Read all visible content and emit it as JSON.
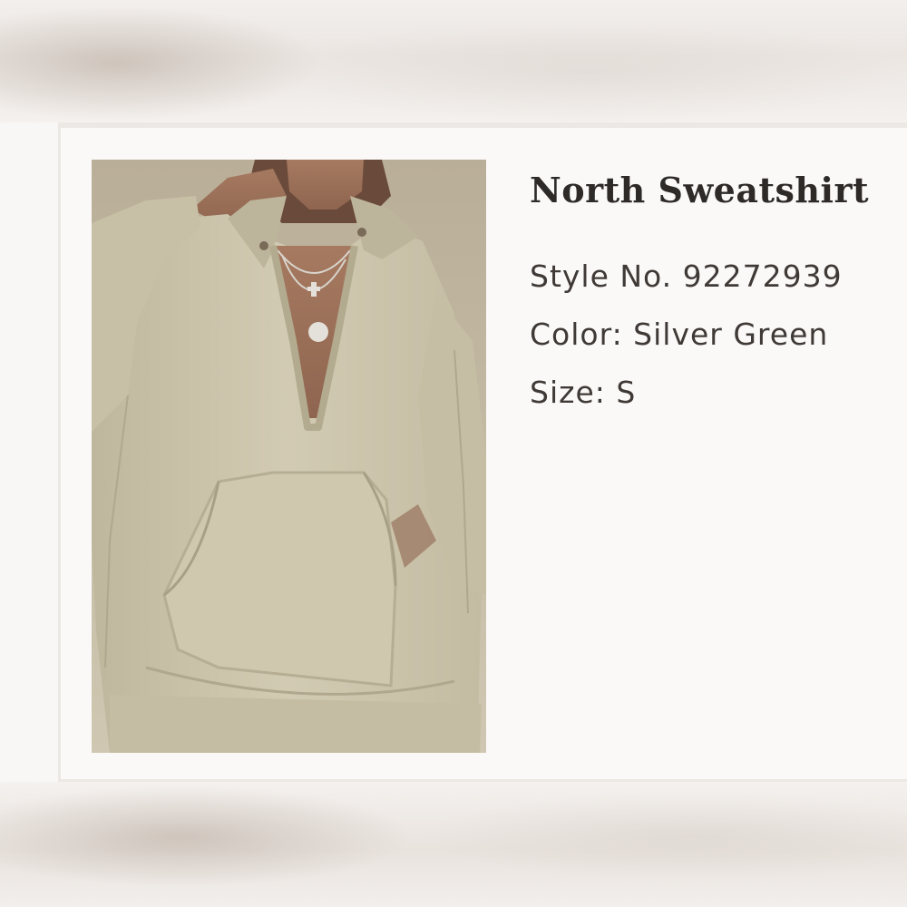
{
  "product": {
    "name": "North Sweatshirt",
    "style": "Style No. 92272939",
    "color": "Color: Silver Green",
    "size": "Size: S"
  },
  "image": {
    "icon": "product-photo-sweatshirt",
    "garment_color": "#cdc6ad",
    "background_color": "#c9c1ab"
  }
}
